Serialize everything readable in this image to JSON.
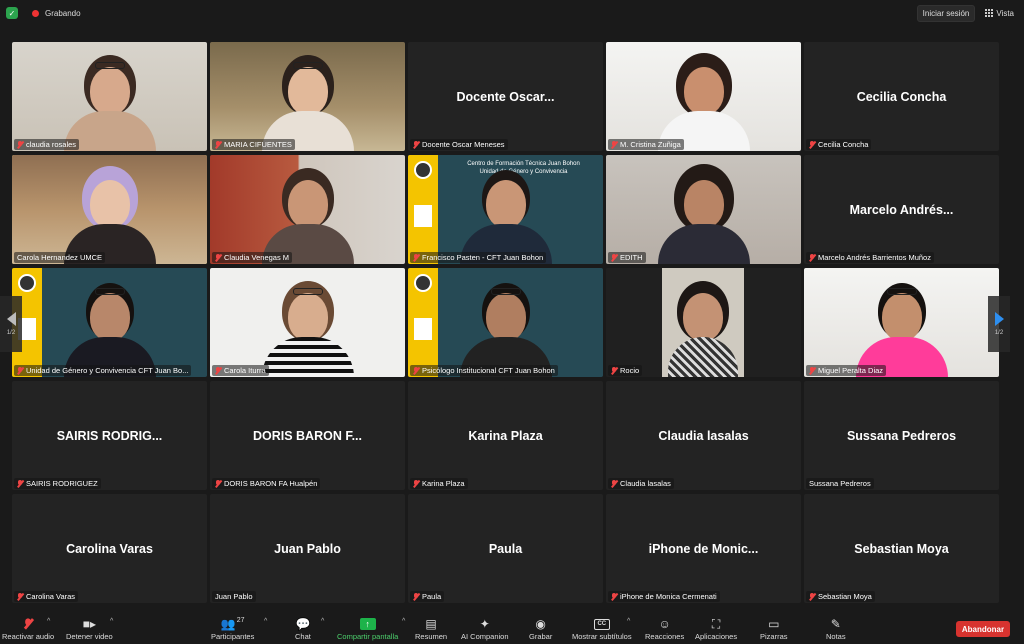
{
  "topbar": {
    "recording_label": "Grabando",
    "signin_label": "Iniciar sesión",
    "view_label": "Vista"
  },
  "pager": {
    "left_label": "1/2",
    "right_label": "1/2"
  },
  "participants": [
    {
      "label": "claudia rosales",
      "big_name": "",
      "muted": true,
      "video": true
    },
    {
      "label": "MARIA CIFUENTES",
      "big_name": "",
      "muted": true,
      "video": true
    },
    {
      "label": "Docente Oscar Meneses",
      "big_name": "Docente Oscar...",
      "muted": true,
      "video": false
    },
    {
      "label": "M. Cristina Zuñiga",
      "big_name": "",
      "muted": true,
      "video": true
    },
    {
      "label": "Cecilia Concha",
      "big_name": "Cecilia Concha",
      "muted": true,
      "video": false
    },
    {
      "label": "Carola Hernandez UMCE",
      "big_name": "",
      "muted": false,
      "video": true,
      "active": true
    },
    {
      "label": "Claudia Venegas M",
      "big_name": "",
      "muted": true,
      "video": true
    },
    {
      "label": "Francisco Pasten - CFT Juan Bohon",
      "big_name": "",
      "muted": true,
      "video": true
    },
    {
      "label": "EDITH",
      "big_name": "",
      "muted": true,
      "video": true
    },
    {
      "label": "Marcelo Andrés Barrientos Muñoz",
      "big_name": "Marcelo Andrés...",
      "muted": true,
      "video": false
    },
    {
      "label": "Unidad de Género y Convivencia CFT Juan Bo...",
      "big_name": "",
      "muted": true,
      "video": true
    },
    {
      "label": "Carola Iturra",
      "big_name": "",
      "muted": true,
      "video": true
    },
    {
      "label": "Psicólogo Institucional CFT Juan Bohon",
      "big_name": "",
      "muted": true,
      "video": true
    },
    {
      "label": "Rocio",
      "big_name": "",
      "muted": true,
      "video": true
    },
    {
      "label": "Miguel Peralta Diaz",
      "big_name": "",
      "muted": true,
      "video": true
    },
    {
      "label": "SAIRIS RODRIGUEZ",
      "big_name": "SAIRIS  RODRIG...",
      "muted": true,
      "video": false
    },
    {
      "label": "DORIS BARON FA Hualpén",
      "big_name": "DORIS BARON F...",
      "muted": true,
      "video": false
    },
    {
      "label": "Karina Plaza",
      "big_name": "Karina Plaza",
      "muted": true,
      "video": false
    },
    {
      "label": "Claudia lasalas",
      "big_name": "Claudia lasalas",
      "muted": true,
      "video": false
    },
    {
      "label": "Sussana Pedreros",
      "big_name": "Sussana Pedreros",
      "muted": false,
      "video": false
    },
    {
      "label": "Carolina Varas",
      "big_name": "Carolina Varas",
      "muted": true,
      "video": false
    },
    {
      "label": "Juan Pablo",
      "big_name": "Juan Pablo",
      "muted": false,
      "video": false
    },
    {
      "label": "Paula",
      "big_name": "Paula",
      "muted": true,
      "video": false
    },
    {
      "label": "iPhone de Monica Cermenati",
      "big_name": "iPhone de Monic...",
      "muted": true,
      "video": false
    },
    {
      "label": "Sebastian Moya",
      "big_name": "Sebastian Moya",
      "muted": true,
      "video": false
    }
  ],
  "cft_slide": {
    "title_line1": "Centro de Formación Técnica Juan Bohon",
    "title_line2": "Unidad de Género y Convivencia"
  },
  "toolbar": {
    "unmute": "Reactivar audio",
    "stop_video": "Detener video",
    "participants": "Participantes",
    "participants_count": "27",
    "chat": "Chat",
    "share": "Compartir pantalla",
    "summary": "Resumen",
    "companion": "AI Companion",
    "record": "Grabar",
    "captions": "Mostrar subtítulos",
    "reactions": "Reacciones",
    "apps": "Aplicaciones",
    "whiteboards": "Pizarras",
    "notes": "Notas",
    "end": "Abandonar"
  },
  "colors": {
    "active_speaker": "#d6e57a",
    "share_green": "#1db34a",
    "end_red": "#d7332f",
    "cft_yellow": "#f4c400",
    "cft_teal": "#264a55"
  }
}
